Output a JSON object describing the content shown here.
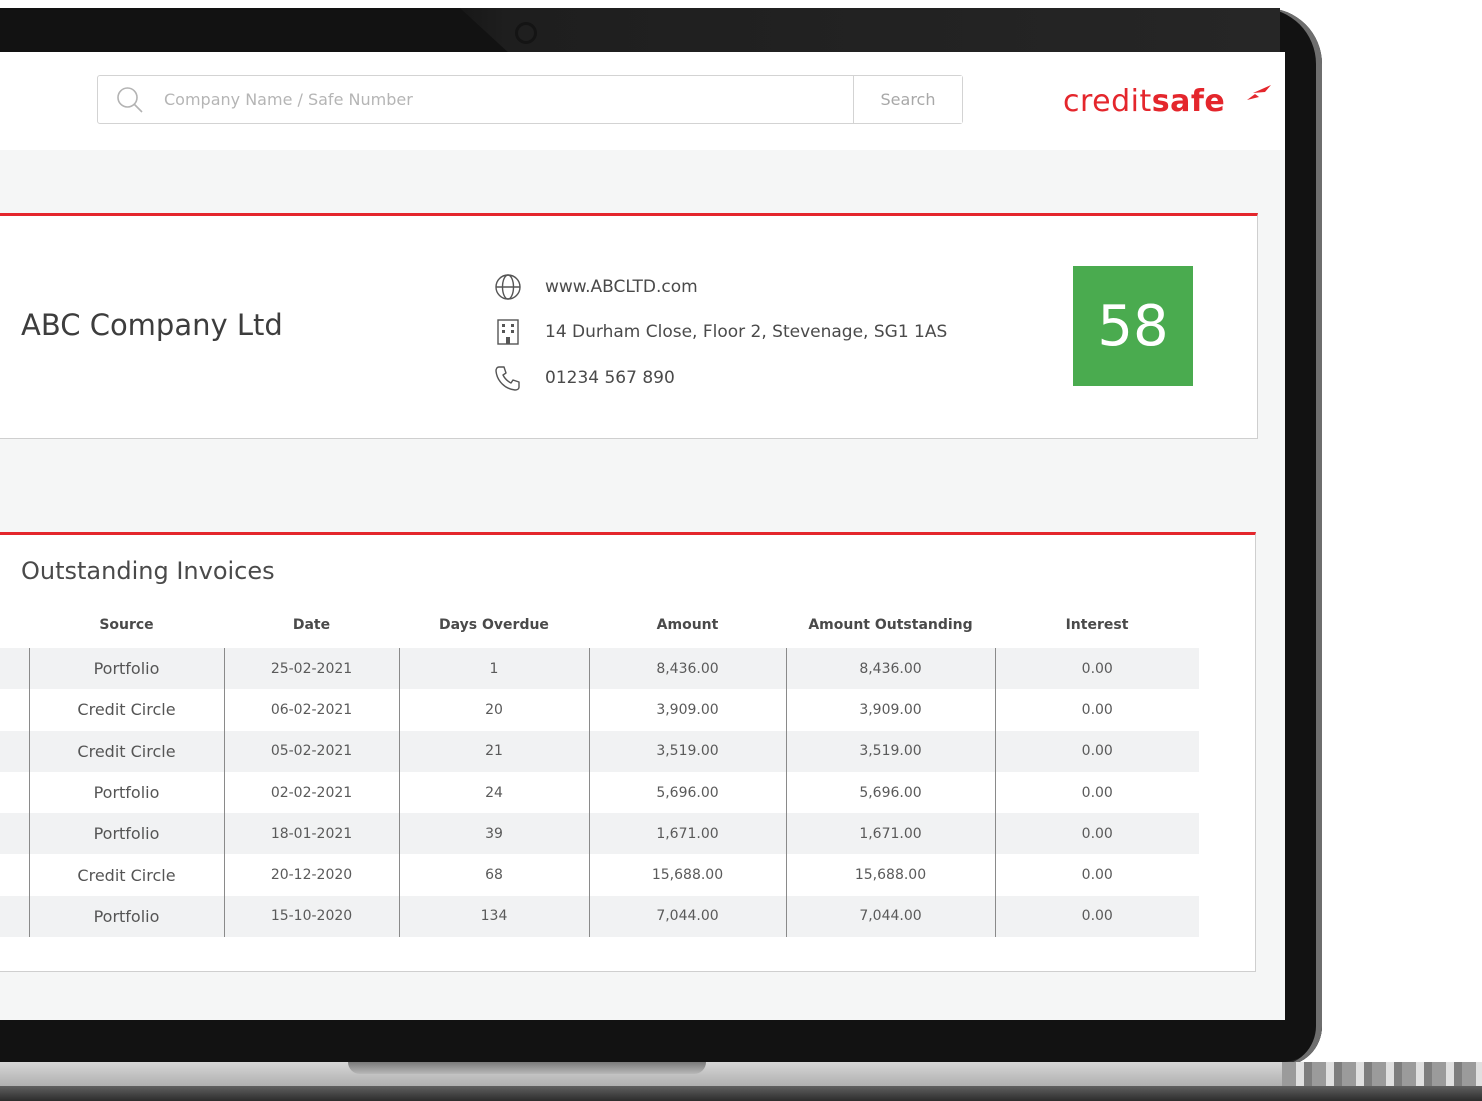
{
  "search": {
    "placeholder": "Company Name / Safe Number",
    "button_label": "Search"
  },
  "brand": {
    "light": "credit",
    "bold": "safe",
    "color": "#e4262c"
  },
  "company": {
    "name": "ABC Company Ltd",
    "website": "www.ABCLTD.com",
    "address": "14 Durham Close, Floor 2, Stevenage, SG1 1AS",
    "phone": "01234 567 890",
    "score": "58",
    "score_color": "#4aab4f"
  },
  "invoices": {
    "title": "Outstanding Invoices",
    "columns": [
      "Source",
      "Date",
      "Days Overdue",
      "Amount",
      "Amount Outstanding",
      "Interest"
    ],
    "rows": [
      {
        "source": "Portfolio",
        "date": "25-02-2021",
        "days_overdue": "1",
        "amount": "8,436.00",
        "outstanding": "8,436.00",
        "interest": "0.00"
      },
      {
        "source": "Credit Circle",
        "date": "06-02-2021",
        "days_overdue": "20",
        "amount": "3,909.00",
        "outstanding": "3,909.00",
        "interest": "0.00"
      },
      {
        "source": "Credit Circle",
        "date": "05-02-2021",
        "days_overdue": "21",
        "amount": "3,519.00",
        "outstanding": "3,519.00",
        "interest": "0.00"
      },
      {
        "source": "Portfolio",
        "date": "02-02-2021",
        "days_overdue": "24",
        "amount": "5,696.00",
        "outstanding": "5,696.00",
        "interest": "0.00"
      },
      {
        "source": "Portfolio",
        "date": "18-01-2021",
        "days_overdue": "39",
        "amount": "1,671.00",
        "outstanding": "1,671.00",
        "interest": "0.00"
      },
      {
        "source": "Credit Circle",
        "date": "20-12-2020",
        "days_overdue": "68",
        "amount": "15,688.00",
        "outstanding": "15,688.00",
        "interest": "0.00"
      },
      {
        "source": "Portfolio",
        "date": "15-10-2020",
        "days_overdue": "134",
        "amount": "7,044.00",
        "outstanding": "7,044.00",
        "interest": "0.00"
      }
    ]
  },
  "icons": {
    "search": "search-icon",
    "website": "globe-icon",
    "address": "building-icon",
    "phone": "phone-icon"
  }
}
